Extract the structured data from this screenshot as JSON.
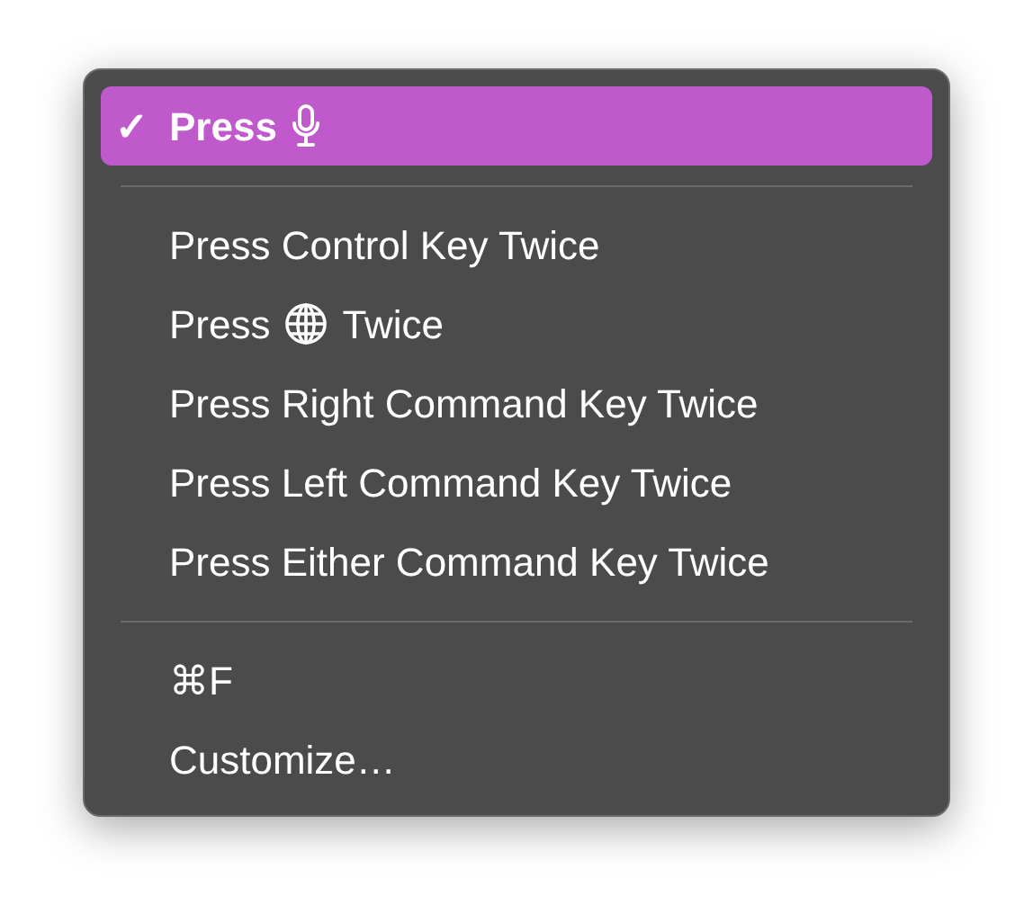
{
  "menu": {
    "sections": [
      {
        "items": [
          {
            "kind": "voice-key",
            "label": "Press",
            "checked": true,
            "selected": true
          }
        ]
      },
      {
        "items": [
          {
            "kind": "text",
            "label": "Press Control Key Twice",
            "checked": false,
            "selected": false
          },
          {
            "kind": "fn-key",
            "label": "Press",
            "suffix": "Twice",
            "checked": false,
            "selected": false
          },
          {
            "kind": "text",
            "label": "Press Right Command Key Twice",
            "checked": false,
            "selected": false
          },
          {
            "kind": "text",
            "label": "Press Left Command Key Twice",
            "checked": false,
            "selected": false
          },
          {
            "kind": "text",
            "label": "Press Either Command Key Twice",
            "checked": false,
            "selected": false
          }
        ]
      },
      {
        "items": [
          {
            "kind": "text",
            "label": "⌘F",
            "checked": false,
            "selected": false
          },
          {
            "kind": "text",
            "label": "Customize…",
            "checked": false,
            "selected": false
          }
        ]
      }
    ],
    "check_glyph": "✓"
  }
}
